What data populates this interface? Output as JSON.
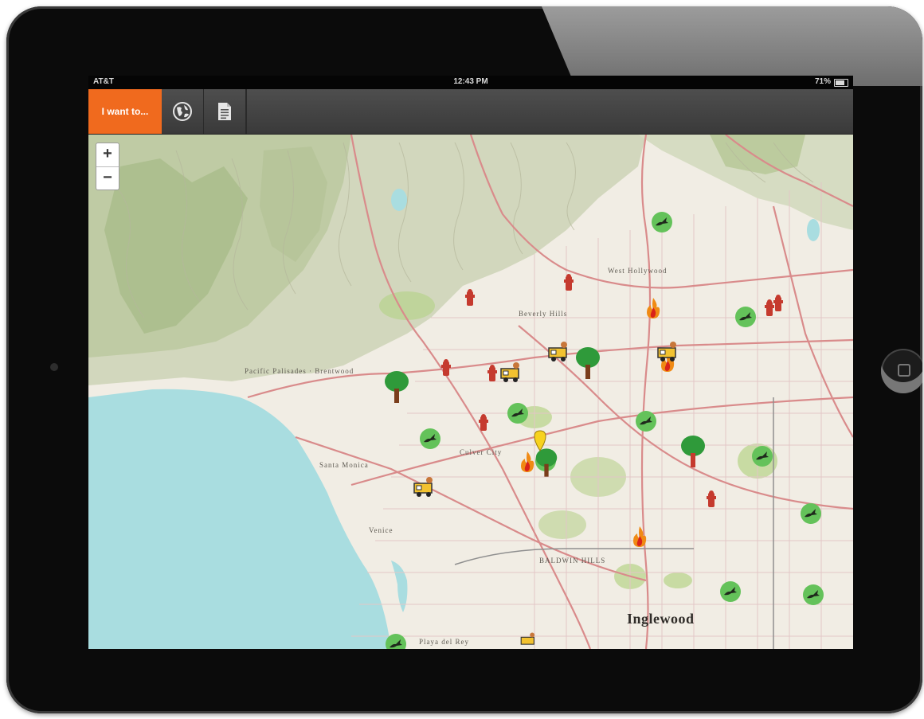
{
  "status_bar": {
    "carrier": "AT&T",
    "time": "12:43 PM",
    "battery": "71%"
  },
  "toolbar": {
    "i_want_label": "I want to...",
    "basemap_icon": "globe-icon",
    "legend_icon": "document-icon"
  },
  "map_controls": {
    "zoom_in": "+",
    "zoom_out": "−"
  },
  "map_labels": {
    "west_hollywood": "West Hollywood",
    "beverly_hills": "Beverly Hills",
    "culver_city": "Culver City",
    "baldwin_hills": "BALDWIN HILLS",
    "inglewood": "Inglewood",
    "santa_monica": "Santa Monica",
    "venice": "Venice",
    "pacific_palisades": "Pacific Palisades · Brentwood",
    "playa_del_rey": "Playa del Rey"
  },
  "colors": {
    "toolbar_accent": "#f06a1e",
    "ocean": "#a9dde0",
    "land": "#f1ede4",
    "hills": "#cfd6b8",
    "marker_green": "#64c25a",
    "hydrant_red": "#c53a2e"
  }
}
